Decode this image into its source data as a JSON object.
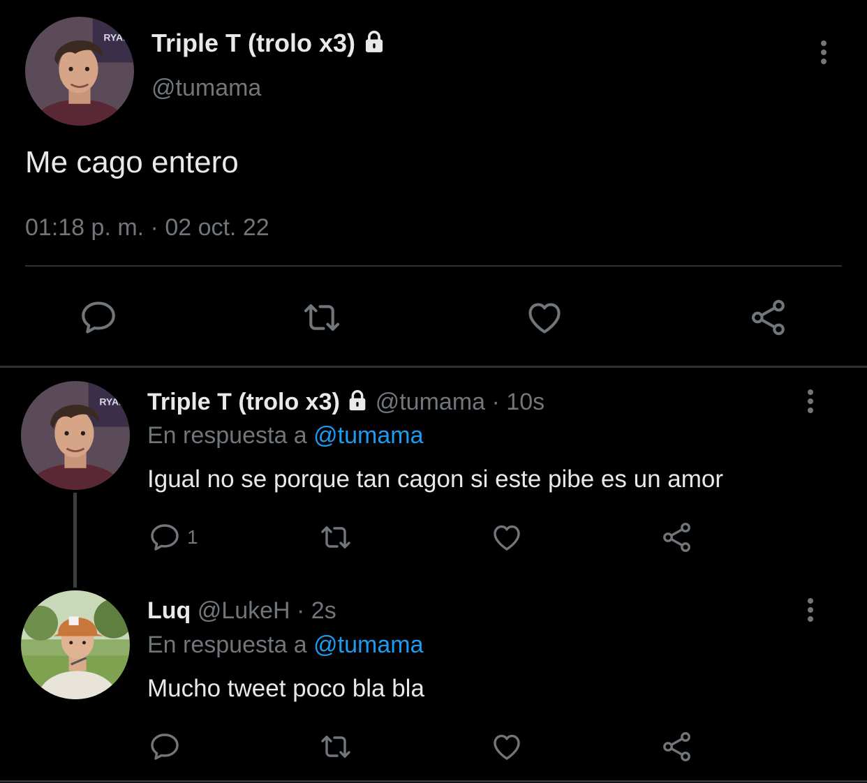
{
  "main_tweet": {
    "display_name": "Triple T (trolo x3)",
    "handle": "@tumama",
    "text": "Me cago entero",
    "timestamp": "01:18 p. m. · 02 oct. 22"
  },
  "replies": [
    {
      "display_name": "Triple T (trolo x3)",
      "handle": "@tumama",
      "time": "· 10s",
      "reply_prefix": "En respuesta a",
      "reply_to": "@tumama",
      "text": "Igual no se porque tan cagon si este pibe es un amor",
      "reply_count": "1"
    },
    {
      "display_name": "Luq",
      "handle": "@LukeH",
      "time": "· 2s",
      "reply_prefix": "En respuesta a",
      "reply_to": "@tumama",
      "text": "Mucho tweet poco bla bla",
      "reply_count": ""
    }
  ],
  "icons": {
    "reply": "speech-bubble-icon",
    "retweet": "retweet-arrows-icon",
    "like": "heart-icon",
    "share": "share-nodes-icon",
    "more": "vertical-dots-icon",
    "protected": "lock-icon"
  },
  "colors": {
    "background": "#000000",
    "text": "#e7e9ea",
    "muted": "#71767b",
    "link": "#1d9bf0",
    "divider": "#2f3336"
  }
}
